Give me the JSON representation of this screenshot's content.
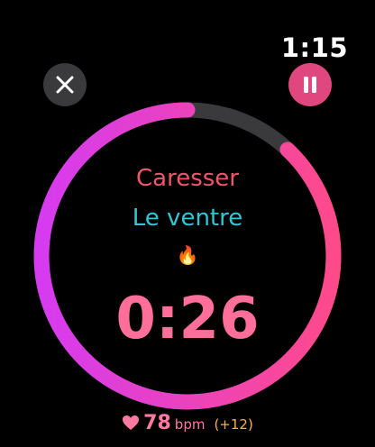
{
  "status": {
    "time": "1:15"
  },
  "controls": {
    "close_icon": "close-icon",
    "pause_icon": "pause-icon"
  },
  "exercise": {
    "title": "Caresser",
    "subtitle": "Le ventre",
    "icon": "🔥",
    "timer": "0:26",
    "progress": 0.88
  },
  "heart": {
    "icon": "heart-icon",
    "bpm": "78",
    "unit": "bpm",
    "delta": "(+12)"
  },
  "colors": {
    "background": "#000000",
    "title": "#f0566a",
    "subtitle": "#2ec7d3",
    "timer": "#ff6f9a",
    "ring_track": "#3a3a3c",
    "ring_gradient_start": "#d63bf0",
    "ring_gradient_end": "#ff4a8a",
    "pause_bg": "#e0477e",
    "close_bg": "#3a3a3c",
    "heart": "#ff7aa2",
    "bpm_value": "#ff7aa2",
    "bpm_unit": "#ff7aa2",
    "delta": "#ffb347"
  }
}
